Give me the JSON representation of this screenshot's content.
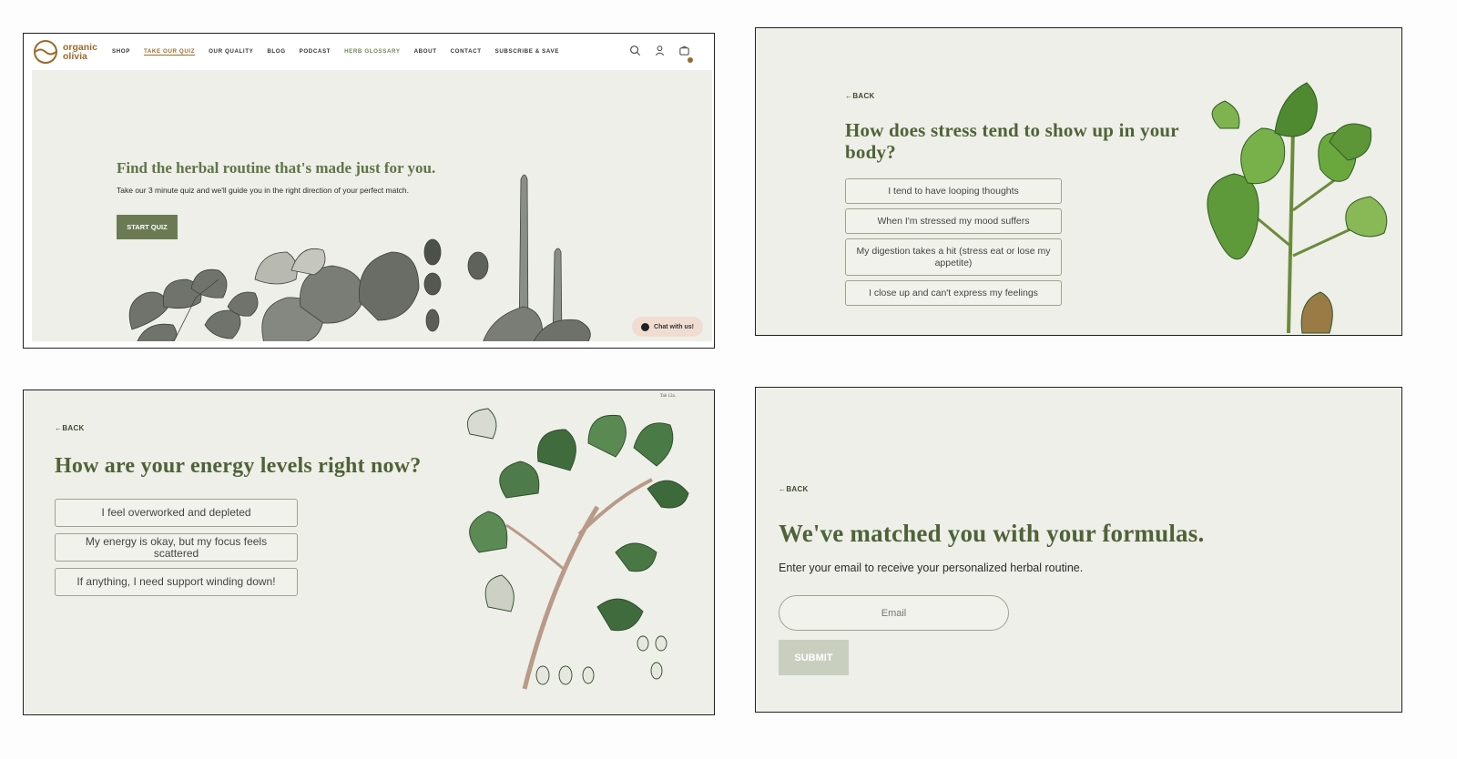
{
  "homepage": {
    "logo": {
      "line1": "organic",
      "line2": "olivia"
    },
    "nav": [
      "SHOP",
      "TAKE OUR QUIZ",
      "OUR QUALITY",
      "BLOG",
      "PODCAST",
      "HERB GLOSSARY",
      "ABOUT",
      "CONTACT",
      "SUBSCRIBE & SAVE"
    ],
    "active_nav": "TAKE OUR QUIZ",
    "icons": [
      "search-icon",
      "account-icon",
      "cart-icon"
    ],
    "hero_title": "Find the herbal routine that's made just for you.",
    "hero_subtitle": "Take our 3 minute quiz and we'll guide you in the right direction of your perfect match.",
    "start_button": "START QUIZ",
    "chat_label": "Chat with us!"
  },
  "stress_question": {
    "back": "BACK",
    "title": "How does stress tend to show up in your body?",
    "options": [
      "I tend to have looping thoughts",
      "When I'm stressed my mood suffers",
      "My digestion takes a hit (stress eat or lose my appetite)",
      "I close up and can't express my feelings"
    ]
  },
  "energy_question": {
    "back": "BACK",
    "title": "How are your energy levels right now?",
    "options": [
      "I feel overworked and depleted",
      "My energy is okay, but my focus feels scattered",
      "If anything, I need support winding down!"
    ],
    "plate_label": "Tab 12a."
  },
  "results": {
    "back": "BACK",
    "title": "We've matched you with your formulas.",
    "subtitle": "Enter your email to receive your personalized herbal routine.",
    "email_placeholder": "Email",
    "submit": "SUBMIT"
  },
  "colors": {
    "brand_gold": "#9a6a2a",
    "heading_green": "#4f6238",
    "button_green": "#6b7a52",
    "panel_bg": "#eeefe8",
    "disabled_button": "#c9cfbf"
  }
}
